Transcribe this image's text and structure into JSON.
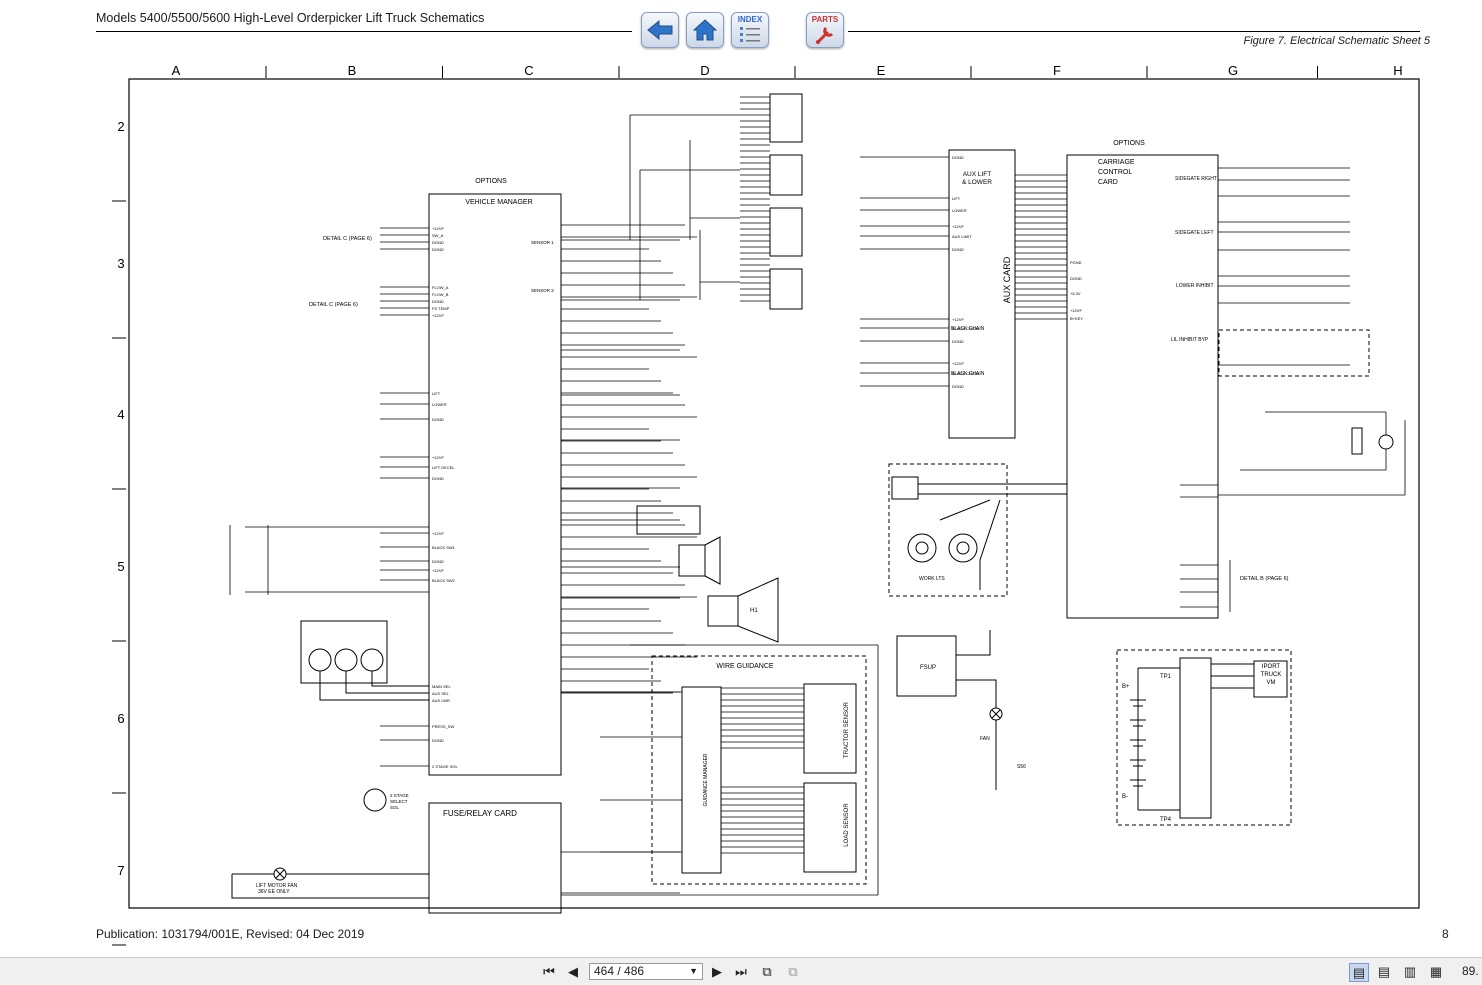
{
  "header": {
    "title": "Models 5400/5500/5600 High-Level Orderpicker Lift Truck Schematics",
    "figure_caption": "Figure 7.  Electrical Schematic Sheet 5",
    "nav": {
      "index_label": "INDEX",
      "parts_label": "PARTS"
    }
  },
  "grid": {
    "columns": [
      "A",
      "B",
      "C",
      "D",
      "E",
      "F",
      "G",
      "H"
    ],
    "rows": [
      "2",
      "3",
      "4",
      "5",
      "6",
      "7"
    ]
  },
  "blocks": {
    "vehicle_manager": "VEHICLE MANAGER",
    "options_vm": "OPTIONS",
    "options_carriage": "OPTIONS",
    "carriage_control_card": [
      "CARRIAGE",
      "CONTROL",
      "CARD"
    ],
    "aux_card": "AUX CARD",
    "aux_lift_lower": [
      "AUX LIFT",
      "& LOWER"
    ],
    "fuse_relay_card": "FUSE/RELAY CARD",
    "wire_guidance": "WIRE GUIDANCE",
    "guidance_manager": "GUIDANCE MANAGER",
    "tractor_sensor": "TRACTOR SENSOR",
    "load_sensor": "LOAD SENSOR",
    "fsup": "FSUP",
    "iport": [
      "IPORT",
      "TRUCK",
      "VM"
    ],
    "work_lts": "WORK LTS",
    "detail_c_1": "DETAIL C (PAGE 6)",
    "detail_c_2": "DETAIL C (PAGE 6)",
    "detail_b": "DETAIL B (PAGE 6)",
    "lift_motor_fan": [
      "LIFT MOTOR FAN",
      "36V EE ONLY"
    ],
    "tp1": "TP1",
    "tp4": "TP4",
    "b_plus": "B+",
    "b_minus": "B-",
    "fan": "FAN",
    "s56": "S56",
    "h1": "H1",
    "stage_select": [
      "2 STAGE",
      "SELECT",
      "SOL"
    ],
    "sidegate_right": "SIDEGATE RIGHT",
    "sidegate_left": "SIDEGATE LEFT",
    "lower_inhibit": "LOWER INHIBIT",
    "lil_inhibit_byp": "LIL INHIBIT BYP",
    "black_chain_1": "BLACK CHAIN",
    "black_chain_2": "BLACK CHAIN",
    "sensor_1": "SENSOR 1",
    "sensor_2": "SENSOR 2",
    "vm_pins": [
      "+12VF",
      "SW_A",
      "DGND",
      "DGND",
      "FLOW_A",
      "FLOW_B",
      "DGND",
      "FS TEMP",
      "+12VF",
      "LIFT",
      "LOWER",
      "DGND",
      "+12VF",
      "LIFT DECEL",
      "DGND",
      "+12VF",
      "BLACK SW1",
      "DGND",
      "+12VF",
      "BLACK SW2",
      "MAIN SEL",
      "AUX SEL",
      "AUX LWR",
      "PRESS_SW",
      "DGND",
      "2 STAGE SOL"
    ],
    "aux_pins": [
      "DGND",
      "LIFT",
      "LOWER",
      "+12VF",
      "AUX LIMIT",
      "DGND",
      "+12VF",
      "BLACK CHAIN",
      "DGND",
      "+12VF",
      "BLACK CHAIN",
      "DGND"
    ],
    "cc_pins": [
      "PGND",
      "DGND",
      "+5.3V",
      "+12VF",
      "B+KEY"
    ]
  },
  "footer": {
    "publication": "Publication: 1031794/001E, Revised: 04 Dec 2019",
    "page_number": "8"
  },
  "viewer": {
    "page_indicator": "464 / 486",
    "zoom": "89."
  }
}
